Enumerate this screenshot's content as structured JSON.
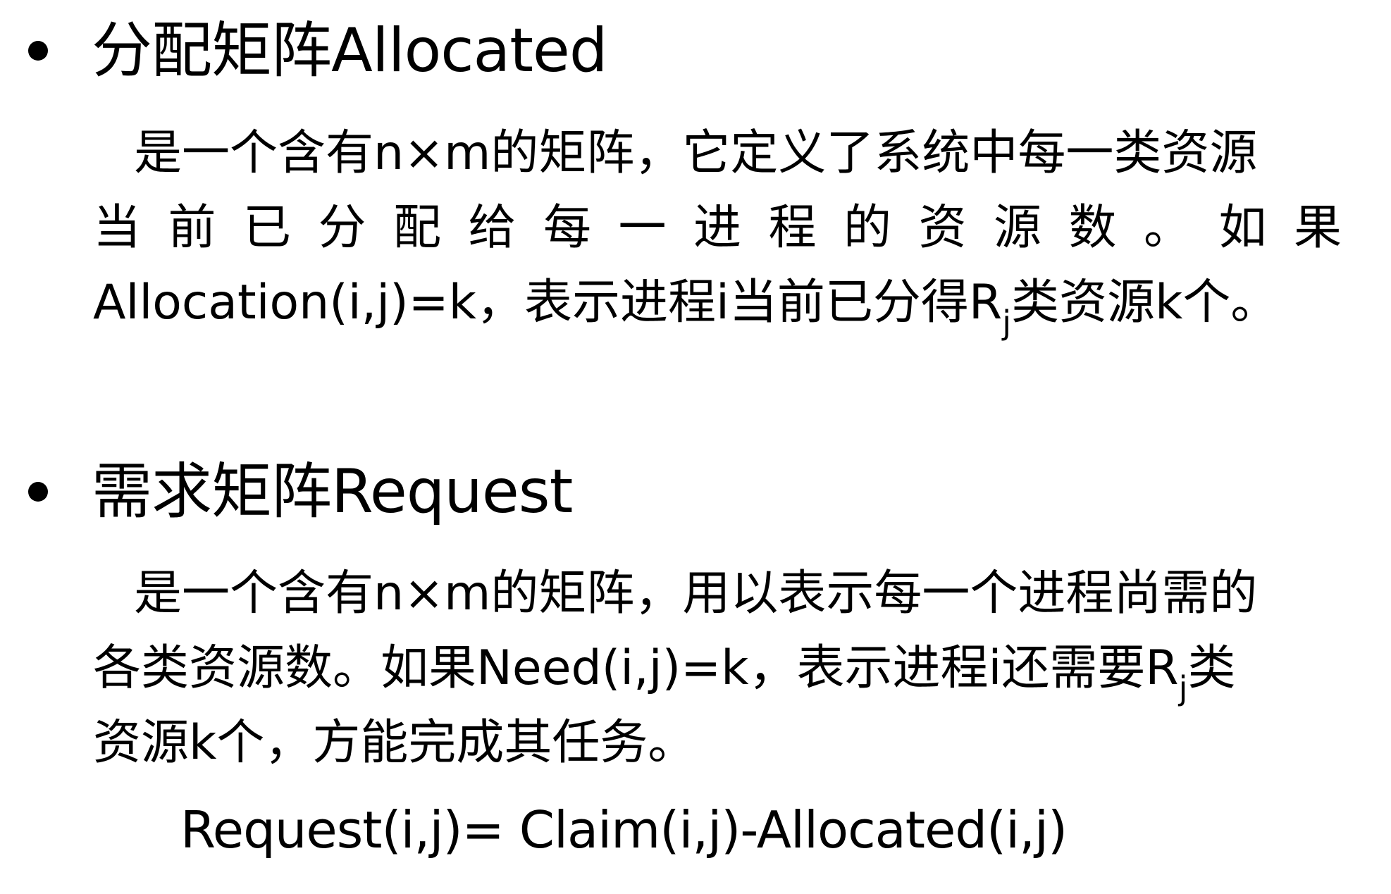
{
  "section1": {
    "heading": "分配矩阵Allocated",
    "lines": [
      "是一个含有n×m的矩阵，它定义了系统中每一类资源",
      "当前已分配给每一进程的资源数。如果"
    ],
    "line3_pre": "Allocation(i,j)=k，表示进程i当前已分得R",
    "line3_sub": "j",
    "line3_post": "类资源k个。"
  },
  "section2": {
    "heading": "需求矩阵Request",
    "line1": "是一个含有n×m的矩阵，用以表示每一个进程尚需的",
    "line2_pre": "各类资源数。如果Need(i,j)=k，表示进程i还需要R",
    "line2_sub": "j",
    "line2_post": "类",
    "line3": "资源k个，方能完成其任务。",
    "formula": "Request(i,j)= Claim(i,j)-Allocated(i,j)"
  }
}
